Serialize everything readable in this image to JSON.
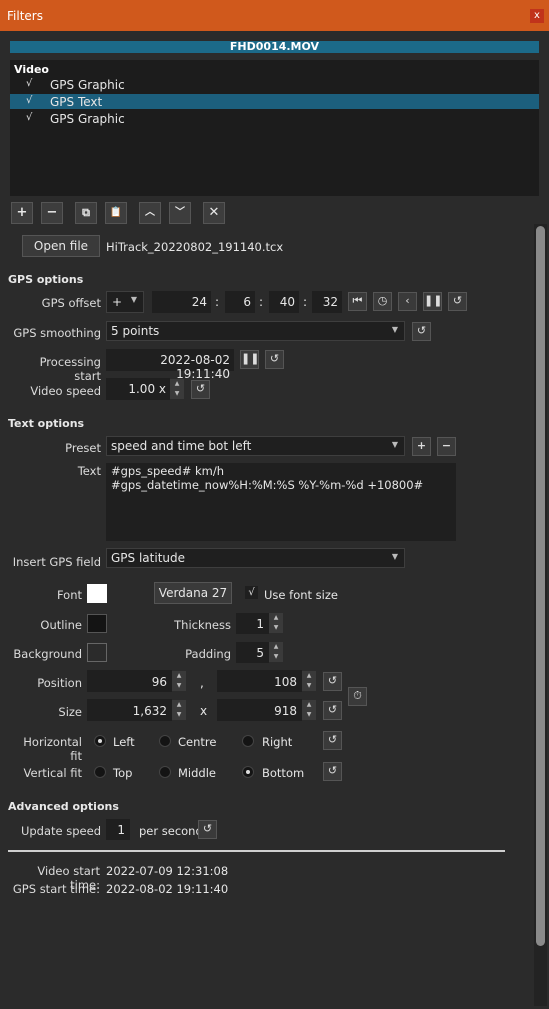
{
  "window": {
    "title": "Filters",
    "close": "x"
  },
  "clip": {
    "name": "FHD0014.MOV"
  },
  "filters": {
    "header": "Video",
    "items": [
      {
        "checked": "√",
        "label": "GPS Graphic",
        "selected": false
      },
      {
        "checked": "√",
        "label": "GPS Text",
        "selected": true
      },
      {
        "checked": "√",
        "label": "GPS Graphic",
        "selected": false
      }
    ]
  },
  "toolbar": {
    "add": "+",
    "remove": "−",
    "copy": "⧉",
    "paste": "📋",
    "up": "︿",
    "down": "﹀",
    "deselect": "✕"
  },
  "file": {
    "open_label": "Open file",
    "name": "HiTrack_20220802_191140.tcx"
  },
  "gps_options": {
    "title": "GPS options",
    "offset_label": "GPS offset",
    "offset_sign": "+",
    "offset_days": "24",
    "offset_hours": "6",
    "offset_minutes": "40",
    "offset_seconds": "32",
    "sep": ":",
    "smoothing_label": "GPS smoothing",
    "smoothing_value": "5 points",
    "processing_label": "Processing start",
    "processing_value": "2022-08-02 19:11:40",
    "speed_label": "Video speed",
    "speed_value": "1.00 x"
  },
  "text_options": {
    "title": "Text options",
    "preset_label": "Preset",
    "preset_value": "speed and time bot left",
    "text_label": "Text",
    "text_line1": "#gps_speed# km/h",
    "text_line2": "#gps_datetime_now%H:%M:%S %Y-%m-%d +10800#",
    "insert_label": "Insert GPS field",
    "insert_value": "GPS latitude",
    "font_label": "Font",
    "font_button": "Verdana 27",
    "use_font_size_check": "√",
    "use_font_size_label": "Use font size",
    "outline_label": "Outline",
    "thickness_label": "Thickness",
    "thickness_value": "1",
    "background_label": "Background",
    "padding_label": "Padding",
    "padding_value": "5",
    "position_label": "Position",
    "pos_x": "96",
    "pos_comma": ",",
    "pos_y": "108",
    "size_label": "Size",
    "size_w": "1,632",
    "size_x": "x",
    "size_h": "918",
    "hfit_label": "Horizontal fit",
    "hfit_options": [
      "Left",
      "Centre",
      "Right"
    ],
    "vfit_label": "Vertical fit",
    "vfit_options": [
      "Top",
      "Middle",
      "Bottom"
    ]
  },
  "advanced": {
    "title": "Advanced options",
    "update_label": "Update speed",
    "update_value": "1",
    "update_unit": "per second"
  },
  "info": {
    "video_start_label": "Video start time:",
    "video_start_value": "2022-07-09 12:31:08",
    "gps_start_label": "GPS start time:",
    "gps_start_value": "2022-08-02 19:11:40"
  },
  "colors": {
    "titlebar": "#d0591c",
    "selection": "#1c5f7d",
    "clipbar": "#1c6a89",
    "font_color": "#ffffff",
    "outline_color": "#141414"
  }
}
